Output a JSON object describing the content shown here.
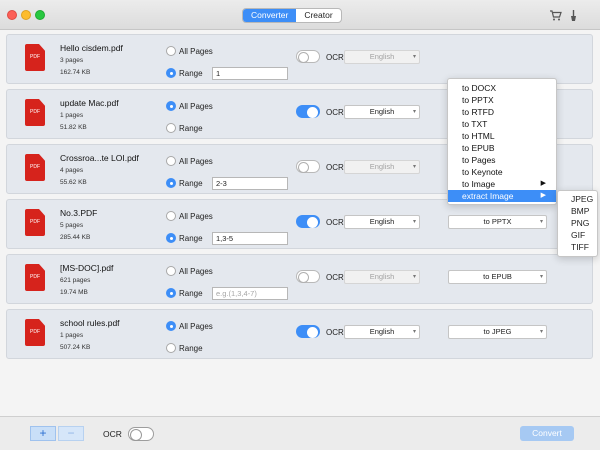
{
  "window": {
    "tabs": [
      "Converter",
      "Creator"
    ],
    "icons": [
      "cart-icon",
      "brush-icon"
    ]
  },
  "colors": {
    "accent": "#3d8ef7",
    "pdf_red": "#d6231c"
  },
  "files": [
    {
      "name": "Hello cisdem.pdf",
      "pages": "3 pages",
      "size": "162.74 KB",
      "all_pages_label": "All Pages",
      "range_label": "Range",
      "page_mode": "range",
      "range_value": "1",
      "range_placeholder": "",
      "ocr_on": false,
      "ocr_label": "OCR",
      "language": "English",
      "format": ""
    },
    {
      "name": "update Mac.pdf",
      "pages": "1 pages",
      "size": "51.82 KB",
      "all_pages_label": "All Pages",
      "range_label": "Range",
      "page_mode": "all",
      "range_value": "",
      "range_placeholder": "",
      "ocr_on": true,
      "ocr_label": "OCR",
      "language": "English",
      "format": ""
    },
    {
      "name": "Crossroa...te LOI.pdf",
      "pages": "4 pages",
      "size": "55.62 KB",
      "all_pages_label": "All Pages",
      "range_label": "Range",
      "page_mode": "range",
      "range_value": "2-3",
      "range_placeholder": "",
      "ocr_on": false,
      "ocr_label": "OCR",
      "language": "English",
      "format": ""
    },
    {
      "name": "No.3.PDF",
      "pages": "5 pages",
      "size": "285.44 KB",
      "all_pages_label": "All Pages",
      "range_label": "Range",
      "page_mode": "range",
      "range_value": "1,3-5",
      "range_placeholder": "",
      "ocr_on": true,
      "ocr_label": "OCR",
      "language": "English",
      "format": "to PPTX"
    },
    {
      "name": "[MS-DOC].pdf",
      "pages": "621 pages",
      "size": "19.74 MB",
      "all_pages_label": "All Pages",
      "range_label": "Range",
      "page_mode": "range",
      "range_value": "",
      "range_placeholder": "e.g.(1,3,4-7)",
      "ocr_on": false,
      "ocr_label": "OCR",
      "language": "English",
      "format": "to EPUB"
    },
    {
      "name": "school rules.pdf",
      "pages": "1 pages",
      "size": "507.24 KB",
      "all_pages_label": "All Pages",
      "range_label": "Range",
      "page_mode": "all",
      "range_value": "",
      "range_placeholder": "",
      "ocr_on": true,
      "ocr_label": "OCR",
      "language": "English",
      "format": "to JPEG"
    }
  ],
  "format_menu": {
    "items": [
      "to DOCX",
      "to PPTX",
      "to RTFD",
      "to TXT",
      "to HTML",
      "to EPUB",
      "to Pages",
      "to Keynote",
      "to Image",
      "extract Image"
    ],
    "active": "extract Image",
    "submenu": [
      "JPEG",
      "BMP",
      "PNG",
      "GIF",
      "TIFF"
    ]
  },
  "bottom": {
    "add": "+",
    "remove": "−",
    "ocr_label": "OCR",
    "convert_label": "Convert"
  }
}
